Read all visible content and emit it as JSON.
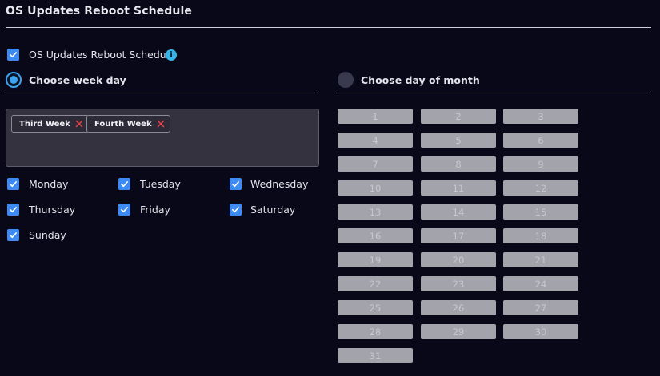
{
  "page": {
    "title": "OS Updates Reboot Schedule"
  },
  "enable": {
    "label": "OS Updates Reboot Schedule",
    "checked": true,
    "info_icon": "info-icon"
  },
  "week_mode": {
    "label": "Choose week day",
    "selected": true
  },
  "month_mode": {
    "label": "Choose day of month",
    "selected": false
  },
  "weeks_selected": [
    {
      "label": "Third Week"
    },
    {
      "label": "Fourth Week"
    }
  ],
  "weekdays": [
    {
      "label": "Monday",
      "checked": true
    },
    {
      "label": "Tuesday",
      "checked": true
    },
    {
      "label": "Wednesday",
      "checked": true
    },
    {
      "label": "Thursday",
      "checked": true
    },
    {
      "label": "Friday",
      "checked": true
    },
    {
      "label": "Saturday",
      "checked": true
    },
    {
      "label": "Sunday",
      "checked": true
    }
  ],
  "month_days": [
    "1",
    "2",
    "3",
    "4",
    "5",
    "6",
    "7",
    "8",
    "9",
    "10",
    "11",
    "12",
    "13",
    "14",
    "15",
    "16",
    "17",
    "18",
    "19",
    "20",
    "21",
    "22",
    "23",
    "24",
    "25",
    "26",
    "27",
    "28",
    "29",
    "30",
    "31"
  ],
  "colors": {
    "accent": "#3d8bf2",
    "radio_accent": "#3da4f2",
    "chip_remove": "#e8424a",
    "day_disabled_bg": "#a3a3ab"
  }
}
